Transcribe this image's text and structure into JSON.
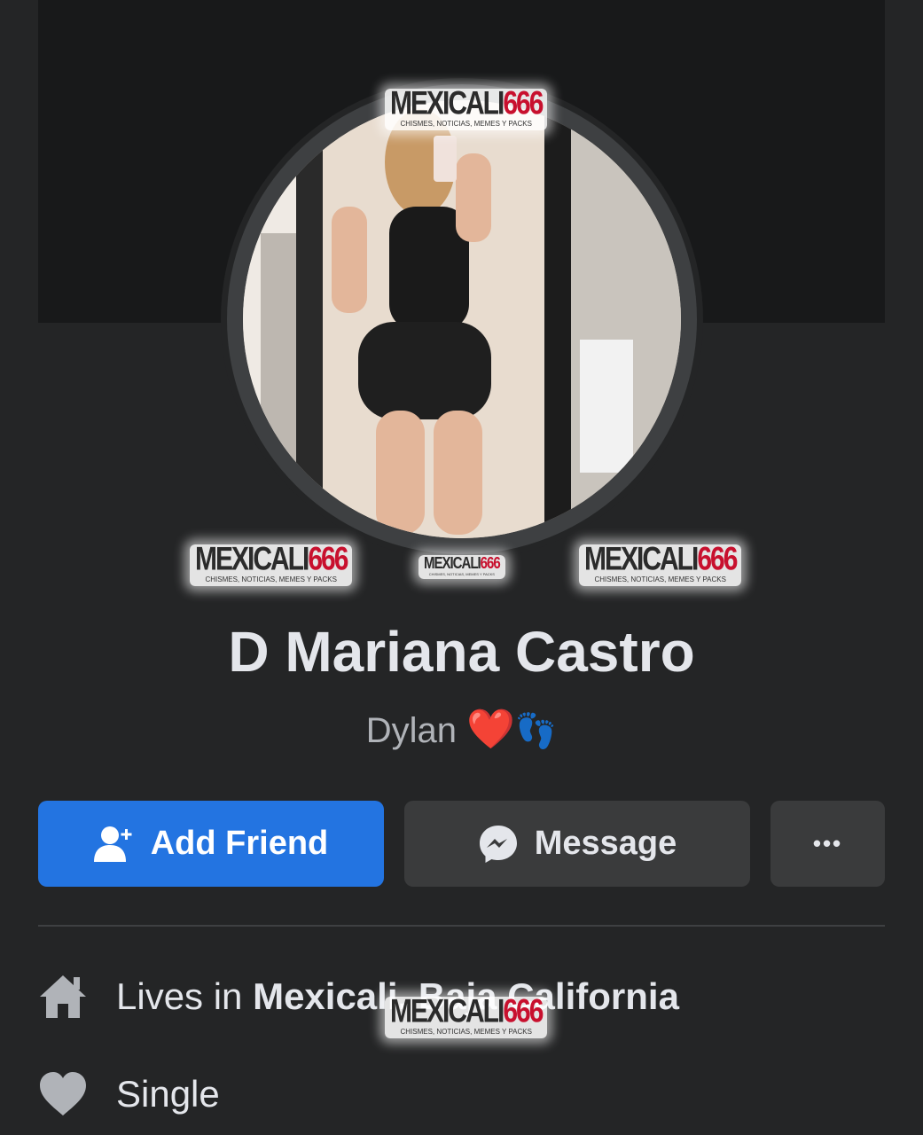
{
  "profile": {
    "name": "D Mariana Castro",
    "bio_text": "Dylan",
    "bio_emoji_heart": "❤️",
    "bio_emoji_feet": "👣"
  },
  "actions": {
    "add_friend": "Add Friend",
    "message": "Message",
    "more": "•••"
  },
  "intro": {
    "lives_prefix": "Lives in",
    "lives_place": "Mexicali, Baja California",
    "relationship": "Single"
  },
  "watermark": {
    "main": "MEXICALI",
    "number": "666",
    "sub": "CHISMES, NOTICIAS, MEMES Y PACKS"
  },
  "icons": {
    "add_friend": "person-plus-icon",
    "message": "messenger-icon",
    "more": "ellipsis-icon",
    "lives": "home-icon",
    "relationship": "heart-icon"
  },
  "colors": {
    "background": "#242526",
    "cover": "#18191a",
    "primary_button": "#2374e1",
    "secondary_button": "#3a3b3c",
    "text": "#e4e6eb",
    "secondary_text": "#b0b3b8",
    "icon_gray": "#b0b3b8"
  }
}
